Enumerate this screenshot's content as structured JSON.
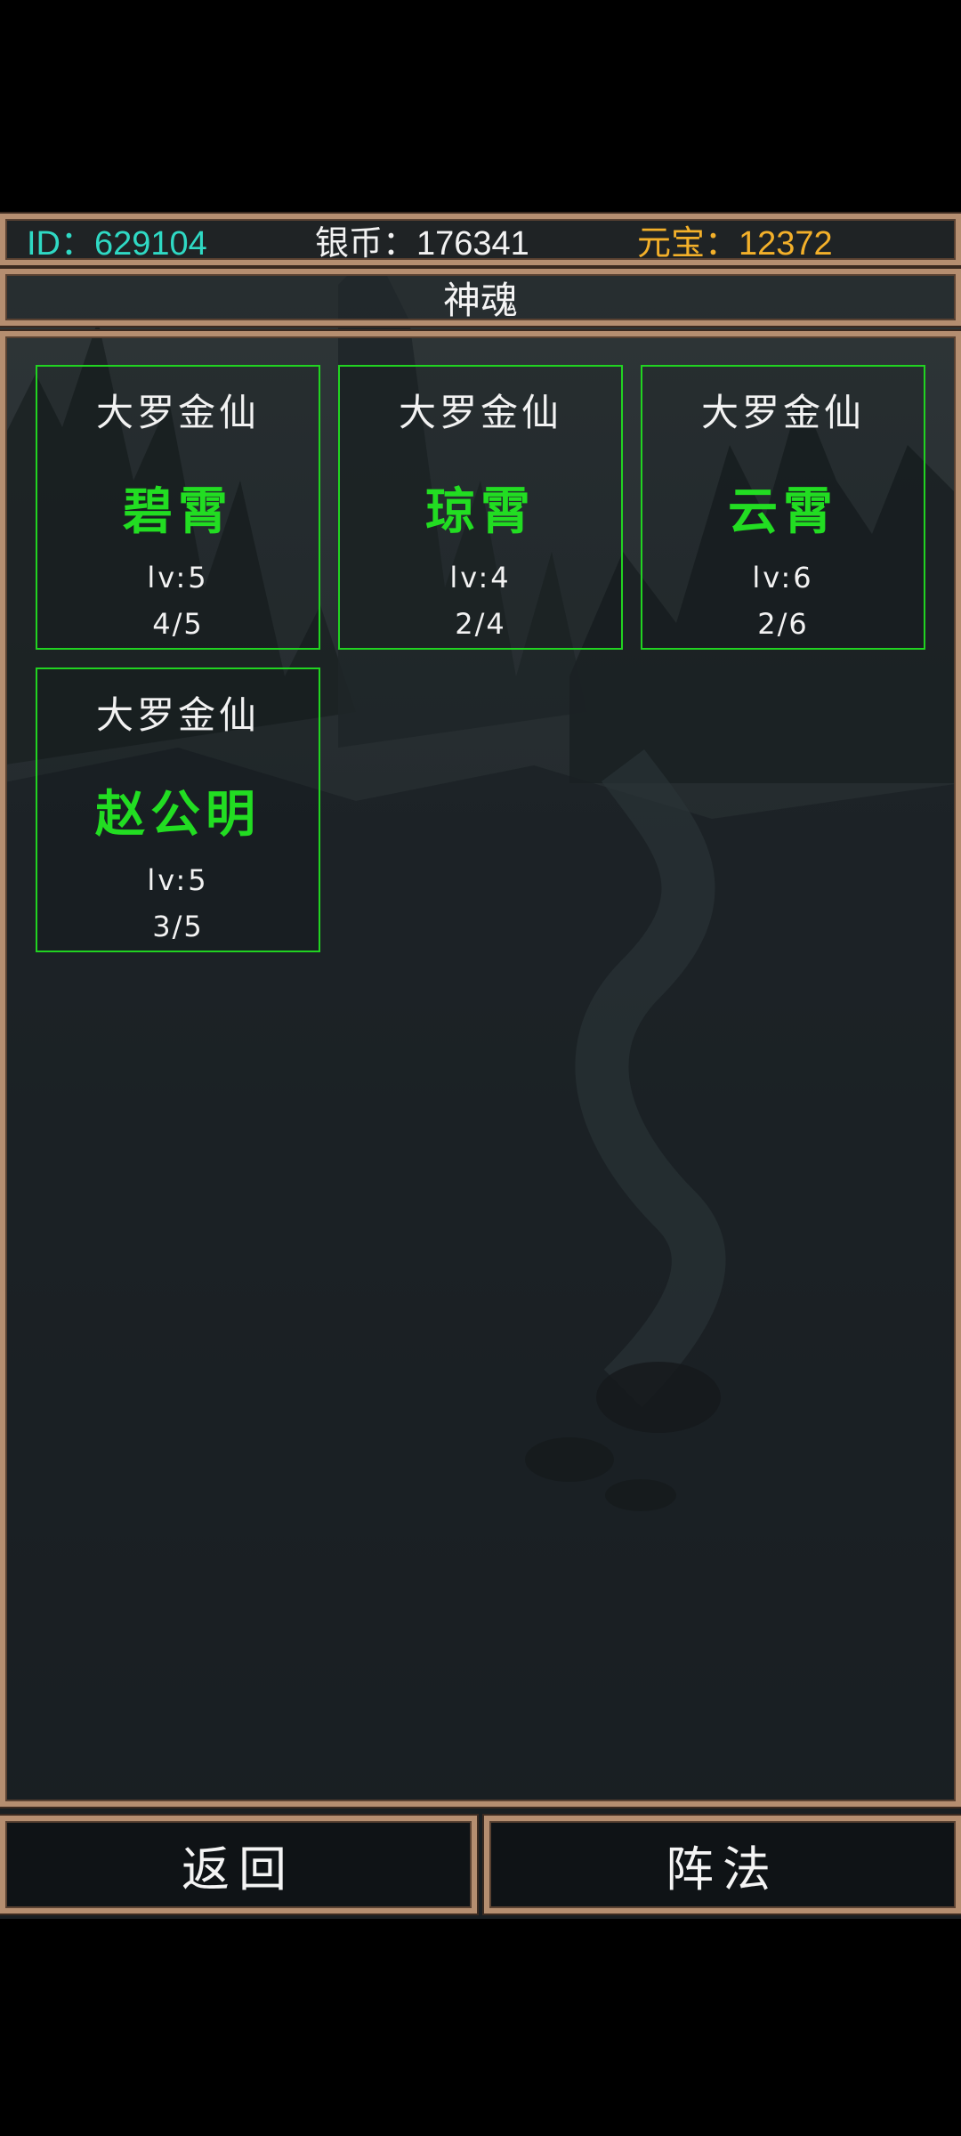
{
  "header": {
    "id_text": "ID：629104",
    "silver_text": "银币：176341",
    "gold_text": "元宝：12372"
  },
  "title": "神魂",
  "cards": [
    {
      "rank": "大罗金仙",
      "name": "碧霄",
      "level": "lv:5",
      "count": "4/5"
    },
    {
      "rank": "大罗金仙",
      "name": "琼霄",
      "level": "lv:4",
      "count": "2/4"
    },
    {
      "rank": "大罗金仙",
      "name": "云霄",
      "level": "lv:6",
      "count": "2/6"
    },
    {
      "rank": "大罗金仙",
      "name": "赵公明",
      "level": "lv:5",
      "count": "3/5"
    }
  ],
  "buttons": {
    "back": "返回",
    "formation": "阵法"
  },
  "colors": {
    "id": "#2fd9c4",
    "silver": "#f2f2f2",
    "gold": "#f3b02a",
    "card_border": "#21d321",
    "card_name": "#22dd22",
    "frame": "#b58e70"
  }
}
